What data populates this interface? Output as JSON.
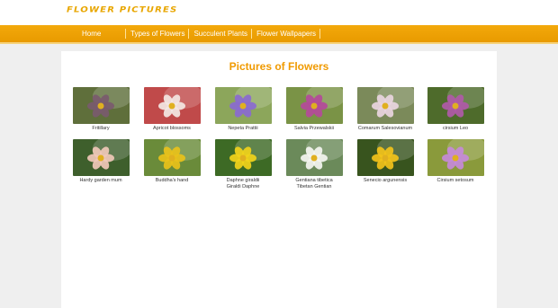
{
  "header": {
    "logo_text": "Flower Pictures"
  },
  "nav": {
    "items": [
      {
        "label": "Home"
      },
      {
        "label": "Types of Flowers"
      },
      {
        "label": "Succulent Plants"
      },
      {
        "label": "Flower Wallpapers"
      }
    ]
  },
  "main": {
    "title": "Pictures of Flowers",
    "gallery": [
      {
        "caption": "Fritillary",
        "icon": "fritillary-icon",
        "bg": "#5f6f3b",
        "petal": "#7a5a6e"
      },
      {
        "caption": "Apricot blossoms",
        "icon": "apricot-blossom-icon",
        "bg": "#c04a4a",
        "petal": "#f3e7e3"
      },
      {
        "caption": "Nepeta Prattii",
        "icon": "nepeta-icon",
        "bg": "#8ca65b",
        "petal": "#8a6ad0"
      },
      {
        "caption": "Salvia Przewalskii",
        "icon": "salvia-icon",
        "bg": "#7a9346",
        "petal": "#b44a9a"
      },
      {
        "caption": "Comarum Salesovianum",
        "icon": "comarum-icon",
        "bg": "#7b8a5a",
        "petal": "#e9d5e0"
      },
      {
        "caption": "cirsium Leo",
        "icon": "thistle-icon",
        "bg": "#4e6b2b",
        "petal": "#b05aa8"
      },
      {
        "caption": "Hardy garden mum",
        "icon": "mum-icon",
        "bg": "#3e5f2c",
        "petal": "#f0c8b8"
      },
      {
        "caption": "Buddha's hand",
        "icon": "buddhas-hand-icon",
        "bg": "#6a8b3a",
        "petal": "#e9c11a"
      },
      {
        "caption": "Daphne giraldii\nGiraldi Daphne",
        "icon": "daphne-icon",
        "bg": "#3d6a25",
        "petal": "#f1d21a"
      },
      {
        "caption": "Gentiana tibetica\nTibetan Gentian",
        "icon": "gentian-icon",
        "bg": "#6b8a5a",
        "petal": "#f4f4f0"
      },
      {
        "caption": "Senecio argunensis",
        "icon": "senecio-icon",
        "bg": "#38541e",
        "petal": "#f2c21a"
      },
      {
        "caption": "Cirsium setosum",
        "icon": "cirsium-icon",
        "bg": "#8a9a3b",
        "petal": "#c68ad8"
      }
    ]
  }
}
